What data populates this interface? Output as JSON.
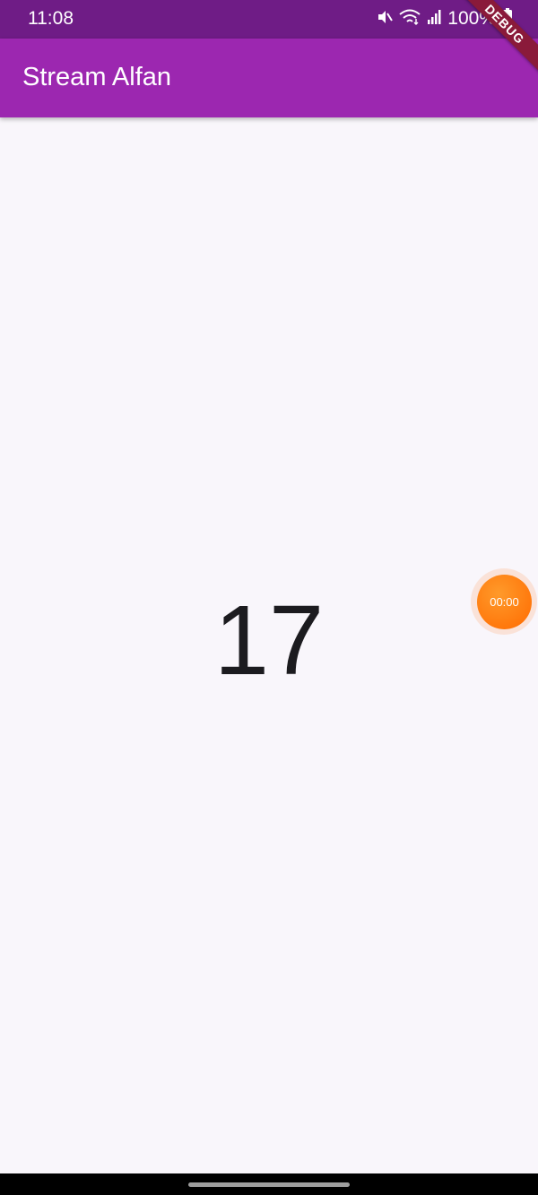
{
  "status_bar": {
    "time": "11:08",
    "battery_text": "100%",
    "icons": [
      "mute-icon",
      "wifi-icon",
      "signal-icon",
      "battery-icon"
    ]
  },
  "app_bar": {
    "title": "Stream Alfan",
    "color": "#9c27b0"
  },
  "debug_banner": "DEBUG",
  "main": {
    "counter_value": "17"
  },
  "floating_timer": {
    "label": "00:00",
    "color": "#ff7a10"
  }
}
